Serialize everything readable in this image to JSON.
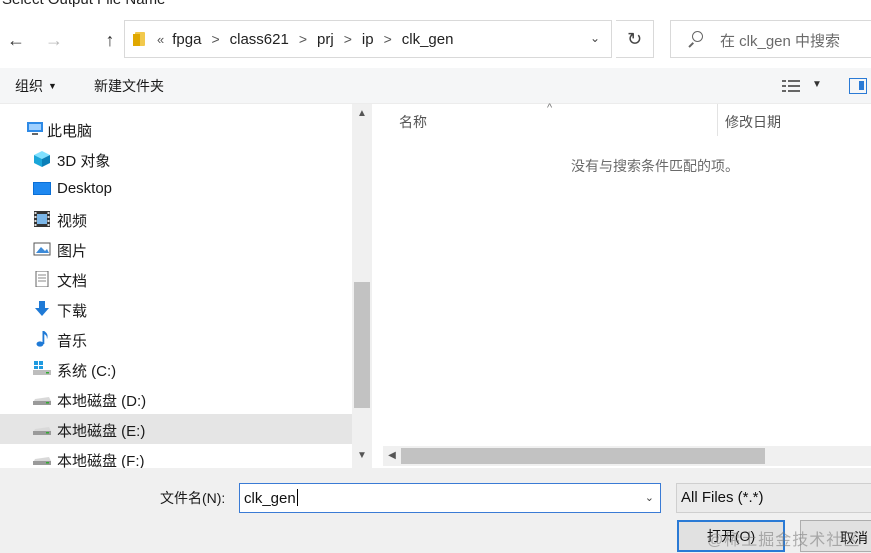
{
  "window": {
    "title": "Select Output File Name"
  },
  "nav": {
    "back": "←",
    "forward": "→",
    "up": "↑"
  },
  "address": {
    "lead": "«",
    "crumbs": [
      "fpga",
      "class621",
      "prj",
      "ip",
      "clk_gen"
    ],
    "separator": ">",
    "dropdown": "⌄",
    "refresh": "↻"
  },
  "search": {
    "placeholder": "在 clk_gen 中搜索"
  },
  "toolbar": {
    "organize": "组织",
    "new_folder": "新建文件夹"
  },
  "tree": {
    "items": [
      {
        "label": "此电脑",
        "icon": "computer-icon"
      },
      {
        "label": "3D 对象",
        "icon": "cube-3d-icon"
      },
      {
        "label": "Desktop",
        "icon": "desktop-icon"
      },
      {
        "label": "视频",
        "icon": "video-icon"
      },
      {
        "label": "图片",
        "icon": "picture-icon"
      },
      {
        "label": "文档",
        "icon": "document-icon"
      },
      {
        "label": "下载",
        "icon": "download-icon"
      },
      {
        "label": "音乐",
        "icon": "music-icon"
      },
      {
        "label": "系统 (C:)",
        "icon": "windows-drive-icon"
      },
      {
        "label": "本地磁盘 (D:)",
        "icon": "drive-icon"
      },
      {
        "label": "本地磁盘 (E:)",
        "icon": "drive-icon",
        "selected": true
      },
      {
        "label": "本地磁盘 (F:)",
        "icon": "drive-icon"
      }
    ]
  },
  "file_list": {
    "columns": {
      "name": "名称",
      "date": "修改日期"
    },
    "empty_message": "没有与搜索条件匹配的项。"
  },
  "bottom": {
    "file_name_label": "文件名(N):",
    "file_name_value": "clk_gen",
    "file_type_value": "All Files (*.*)",
    "open_button": "打开(O)",
    "cancel_button": "取消",
    "watermark": "@稀土掘金技术社区"
  },
  "colors": {
    "accent": "#2a7ad5",
    "selection": "#e5e5e5"
  }
}
